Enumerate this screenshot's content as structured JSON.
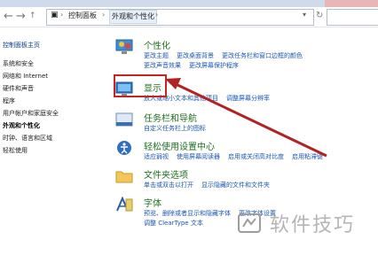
{
  "breadcrumb": {
    "items": [
      "控制面板",
      "外观和个性化"
    ]
  },
  "sidebar": {
    "home": "控制面板主页",
    "items": [
      "系统和安全",
      "网络和 Internet",
      "硬件和声音",
      "程序",
      "用户帐户和家庭安全",
      "外观和个性化",
      "时钟、语言和区域",
      "轻松使用"
    ]
  },
  "categories": [
    {
      "title": "个性化",
      "links": [
        "更改主题",
        "更改桌面背景",
        "更改任务栏和窗口边框的颜色",
        "更改声音效果",
        "更改屏幕保护程序"
      ]
    },
    {
      "title": "显示",
      "links": [
        "放大或缩小文本和其他项目",
        "调整屏幕分辨率"
      ]
    },
    {
      "title": "任务栏和导航",
      "links": [
        "自定义任务栏上的图标"
      ]
    },
    {
      "title": "轻松使用设置中心",
      "links": [
        "适应弱视",
        "使用屏幕阅读器",
        "启用或关闭高对比度",
        "启用粘滞键"
      ]
    },
    {
      "title": "文件夹选项",
      "links": [
        "单击或双击以打开",
        "显示隐藏的文件和文件夹"
      ]
    },
    {
      "title": "字体",
      "links": [
        "预览、删除或者显示和隐藏字体",
        "更改字体设置",
        "调整 ClearType 文本"
      ]
    }
  ],
  "watermark": "软件技巧",
  "colors": {
    "highlight": "#c62424",
    "link": "#1a56b5",
    "category": "#1f6f1f"
  }
}
